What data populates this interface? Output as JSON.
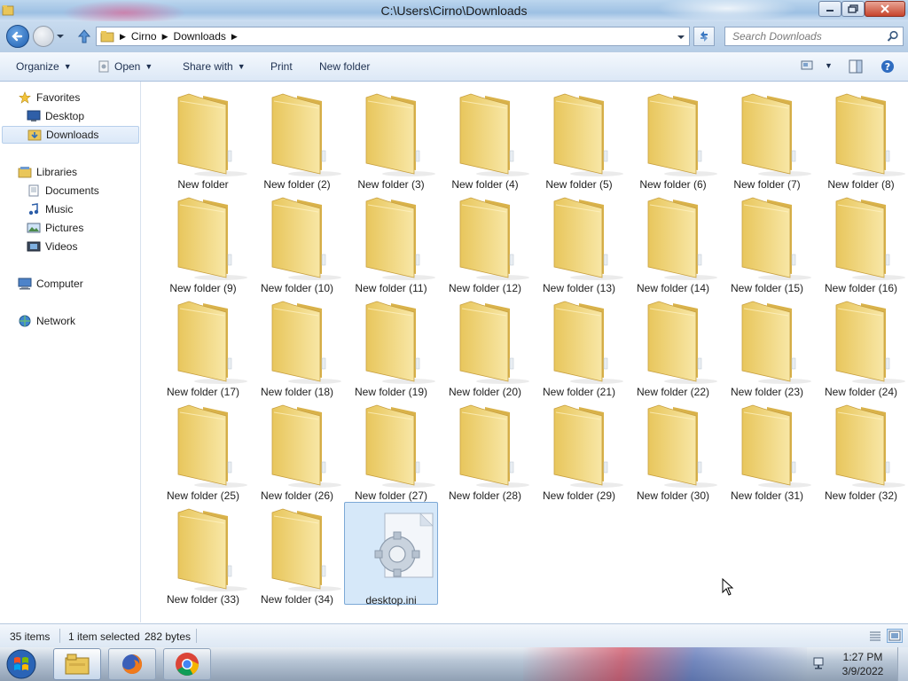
{
  "window": {
    "title": "C:\\Users\\Cirno\\Downloads"
  },
  "address": {
    "crumbs": [
      "Cirno",
      "Downloads"
    ],
    "search_placeholder": "Search Downloads"
  },
  "toolbar": {
    "organize": "Organize",
    "open": "Open",
    "share_with": "Share with",
    "print": "Print",
    "new_folder": "New folder"
  },
  "nav": {
    "favorites": "Favorites",
    "desktop": "Desktop",
    "downloads": "Downloads",
    "libraries": "Libraries",
    "documents": "Documents",
    "music": "Music",
    "pictures": "Pictures",
    "videos": "Videos",
    "computer": "Computer",
    "network": "Network"
  },
  "items": [
    "New folder",
    "New folder (2)",
    "New folder (3)",
    "New folder (4)",
    "New folder (5)",
    "New folder (6)",
    "New folder (7)",
    "New folder (8)",
    "New folder (9)",
    "New folder (10)",
    "New folder (11)",
    "New folder (12)",
    "New folder (13)",
    "New folder (14)",
    "New folder (15)",
    "New folder (16)",
    "New folder (17)",
    "New folder (18)",
    "New folder (19)",
    "New folder (20)",
    "New folder (21)",
    "New folder (22)",
    "New folder (23)",
    "New folder (24)",
    "New folder (25)",
    "New folder (26)",
    "New folder (27)",
    "New folder (28)",
    "New folder (29)",
    "New folder (30)",
    "New folder (31)",
    "New folder (32)",
    "New folder (33)",
    "New folder (34)",
    "desktop.ini"
  ],
  "selected_item": "desktop.ini",
  "status": {
    "count": "35 items",
    "selection": "1 item selected",
    "size": "282 bytes"
  },
  "taskbar": {
    "time": "1:27 PM",
    "date": "3/9/2022",
    "apps": [
      "explorer",
      "firefox",
      "chrome"
    ]
  },
  "colors": {
    "accent": "#1f5fb0",
    "folder": "#f3d77a",
    "selection": "#c4def7"
  }
}
